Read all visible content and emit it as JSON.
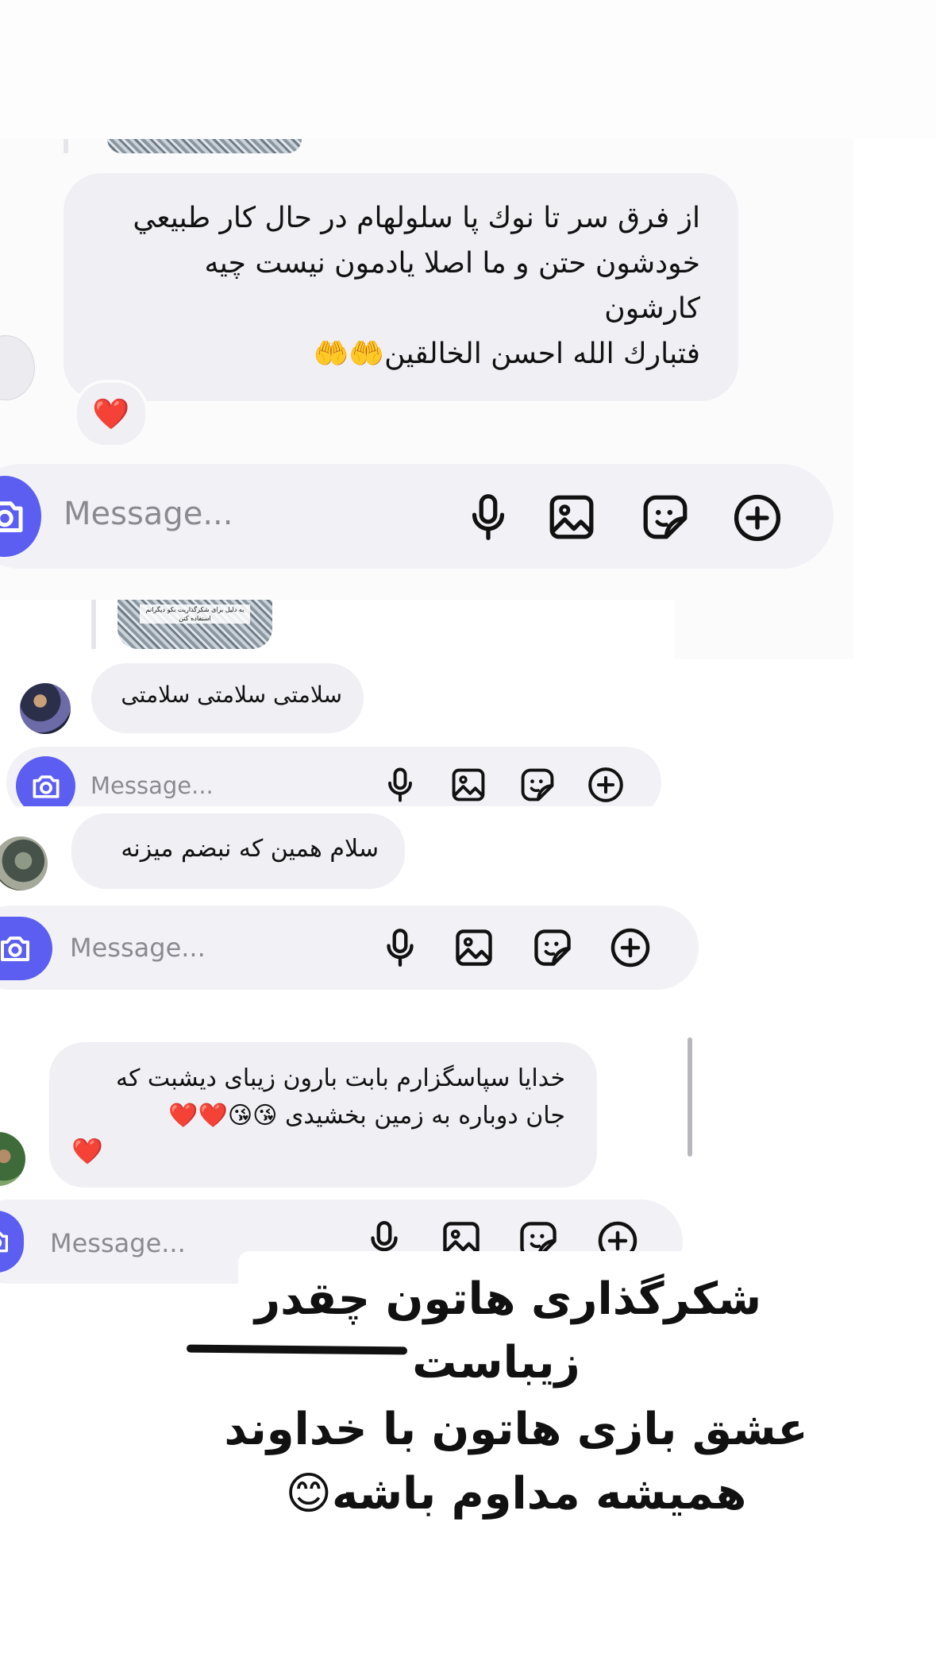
{
  "composer": {
    "placeholder": "Message..."
  },
  "screenshot1": {
    "message_lines": [
      "از فرق سر تا نوك پا سلولهام در حال كار طبيعي",
      "خودشون حتن و ما اصلا يادمون نيست چيه",
      "كارشون",
      "فتبارك الله احسن الخالقين🤲🤲"
    ],
    "reaction": "❤️"
  },
  "screenshot2": {
    "reply_thumb_text": "به دلیل برای شکرگذاریت بکو دیگرانم استفاده کنن",
    "message": "سلامتی سلامتی سلامتی"
  },
  "screenshot3": {
    "message": "سلام همین که نبضم میزنه"
  },
  "screenshot4": {
    "message_lines": [
      "خدایا سپاسگزارم بابت بارون زیبای دیشبت  که",
      "جان دوباره به زمین بخشیدی 😘😘❤️❤️",
      "❤️"
    ]
  },
  "caption": {
    "lines": [
      "شکرگذاری هاتون چقدر",
      "زیباست",
      "عشق بازی هاتون با خداوند",
      "همیشه مداوم باشه😊"
    ]
  },
  "colors": {
    "accent": "#5b5ef0",
    "bubble": "#efeff4",
    "heart": "#e0242c"
  },
  "icons": [
    "camera-icon",
    "microphone-icon",
    "gallery-icon",
    "sticker-icon",
    "plus-circle-icon"
  ]
}
